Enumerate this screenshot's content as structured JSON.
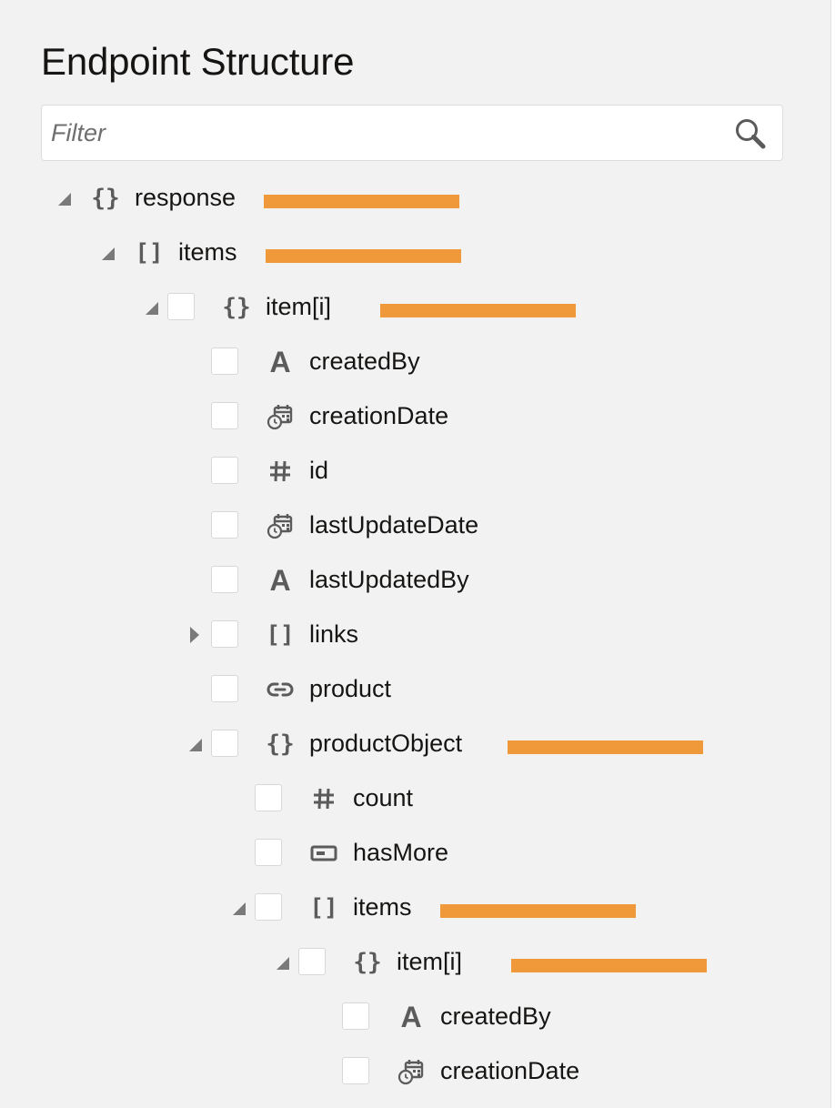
{
  "panel": {
    "title": "Endpoint Structure"
  },
  "filter": {
    "placeholder": "Filter",
    "value": ""
  },
  "colors": {
    "highlight": "#f0993a",
    "icon": "#5b5b5b",
    "background": "#f2f2f2"
  },
  "tree": [
    {
      "label": "response",
      "type": "object",
      "icon": "curly-braces-icon",
      "depth": 0,
      "toggle": "expanded",
      "checkbox": false,
      "highlighted": true
    },
    {
      "label": "items",
      "type": "array",
      "icon": "square-brackets-icon",
      "depth": 1,
      "toggle": "expanded",
      "checkbox": false,
      "highlighted": true
    },
    {
      "label": "item[i]",
      "type": "object",
      "icon": "curly-braces-icon",
      "depth": 2,
      "toggle": "expanded",
      "checkbox": true,
      "highlighted": true
    },
    {
      "label": "createdBy",
      "type": "string",
      "icon": "letter-a-icon",
      "depth": 3,
      "toggle": "none",
      "checkbox": true,
      "highlighted": false
    },
    {
      "label": "creationDate",
      "type": "datetime",
      "icon": "calendar-clock-icon",
      "depth": 3,
      "toggle": "none",
      "checkbox": true,
      "highlighted": false
    },
    {
      "label": "id",
      "type": "number",
      "icon": "hash-icon",
      "depth": 3,
      "toggle": "none",
      "checkbox": true,
      "highlighted": false
    },
    {
      "label": "lastUpdateDate",
      "type": "datetime",
      "icon": "calendar-clock-icon",
      "depth": 3,
      "toggle": "none",
      "checkbox": true,
      "highlighted": false
    },
    {
      "label": "lastUpdatedBy",
      "type": "string",
      "icon": "letter-a-icon",
      "depth": 3,
      "toggle": "none",
      "checkbox": true,
      "highlighted": false
    },
    {
      "label": "links",
      "type": "array",
      "icon": "square-brackets-icon",
      "depth": 3,
      "toggle": "collapsed",
      "checkbox": true,
      "highlighted": false
    },
    {
      "label": "product",
      "type": "link",
      "icon": "link-icon",
      "depth": 3,
      "toggle": "none",
      "checkbox": true,
      "highlighted": false
    },
    {
      "label": "productObject",
      "type": "object",
      "icon": "curly-braces-icon",
      "depth": 3,
      "toggle": "expanded",
      "checkbox": true,
      "highlighted": true
    },
    {
      "label": "count",
      "type": "number",
      "icon": "hash-icon",
      "depth": 4,
      "toggle": "none",
      "checkbox": true,
      "highlighted": false
    },
    {
      "label": "hasMore",
      "type": "boolean",
      "icon": "toggle-box-icon",
      "depth": 4,
      "toggle": "none",
      "checkbox": true,
      "highlighted": false
    },
    {
      "label": "items",
      "type": "array",
      "icon": "square-brackets-icon",
      "depth": 4,
      "toggle": "expanded",
      "checkbox": true,
      "highlighted": true
    },
    {
      "label": "item[i]",
      "type": "object",
      "icon": "curly-braces-icon",
      "depth": 5,
      "toggle": "expanded",
      "checkbox": true,
      "highlighted": true
    },
    {
      "label": "createdBy",
      "type": "string",
      "icon": "letter-a-icon",
      "depth": 6,
      "toggle": "none",
      "checkbox": true,
      "highlighted": false
    },
    {
      "label": "creationDate",
      "type": "datetime",
      "icon": "calendar-clock-icon",
      "depth": 6,
      "toggle": "none",
      "checkbox": true,
      "highlighted": false
    }
  ]
}
